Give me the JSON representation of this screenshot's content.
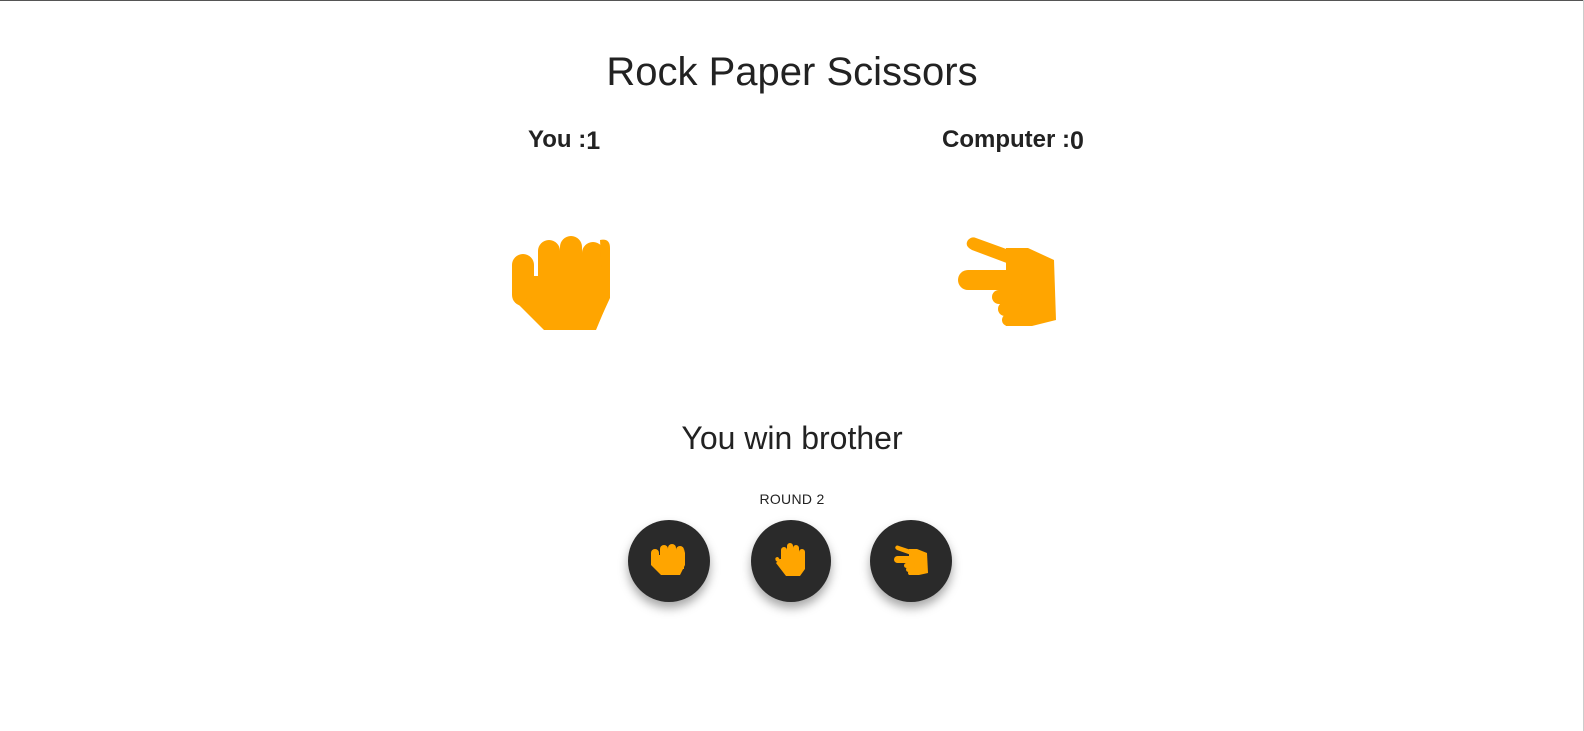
{
  "title": "Rock Paper Scissors",
  "scores": {
    "you_label": "You :",
    "you_value": "1",
    "computer_label": "Computer :",
    "computer_value": "0"
  },
  "hands": {
    "you": "rock-hand-icon",
    "computer": "scissors-hand-icon"
  },
  "result_text": "You win brother",
  "round_text": "ROUND 2",
  "buttons": [
    {
      "name": "rock",
      "icon": "rock-hand-icon"
    },
    {
      "name": "paper",
      "icon": "paper-hand-icon"
    },
    {
      "name": "scissors",
      "icon": "scissors-hand-icon"
    }
  ],
  "colors": {
    "accent": "#FFA500",
    "button_bg": "#2A2A2A",
    "text": "#222222"
  }
}
